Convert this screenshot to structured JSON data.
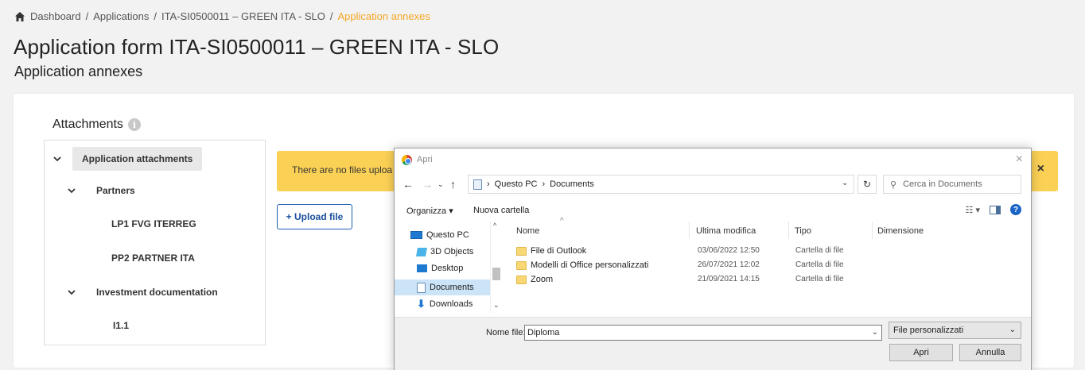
{
  "breadcrumb": {
    "items": [
      "Dashboard",
      "Applications",
      "ITA-SI0500011 – GREEN ITA - SLO"
    ],
    "current": "Application annexes",
    "separator": "/"
  },
  "page": {
    "title": "Application form ITA-SI0500011 – GREEN ITA - SLO",
    "subtitle": "Application annexes"
  },
  "attachments": {
    "title": "Attachments",
    "tree": {
      "root": "Application attachments",
      "partners_group": "Partners",
      "partners": [
        "LP1 FVG ITERREG",
        "PP2 PARTNER ITA"
      ],
      "investment_group": "Investment documentation",
      "investments": [
        "I1.1"
      ]
    },
    "warning_text": "There are no files uploa",
    "warning_close": "×",
    "upload_label": "+ Upload file"
  },
  "dialog": {
    "title": "Apri",
    "close": "×",
    "path": [
      "Questo PC",
      "Documents"
    ],
    "search_placeholder": "Cerca in Documents",
    "organize": "Organizza ▾",
    "new_folder": "Nuova cartella",
    "nav": [
      "Questo PC",
      "3D Objects",
      "Desktop",
      "Documents",
      "Downloads"
    ],
    "columns": {
      "name": "Nome",
      "modified": "Ultima modifica",
      "type": "Tipo",
      "size": "Dimensione"
    },
    "files": [
      {
        "name": "File di Outlook",
        "modified": "03/06/2022 12:50",
        "type": "Cartella di file"
      },
      {
        "name": "Modelli di Office personalizzati",
        "modified": "26/07/2021 12:02",
        "type": "Cartella di file"
      },
      {
        "name": "Zoom",
        "modified": "21/09/2021 14:15",
        "type": "Cartella di file"
      }
    ],
    "filename_label": "Nome file:",
    "filename_value": "Diploma",
    "filetype": "File personalizzati",
    "open_label": "Apri",
    "cancel_label": "Annulla"
  },
  "colors": {
    "accent": "#f5a623",
    "warning_bg": "#fbd155",
    "primary": "#1a5fb4"
  }
}
